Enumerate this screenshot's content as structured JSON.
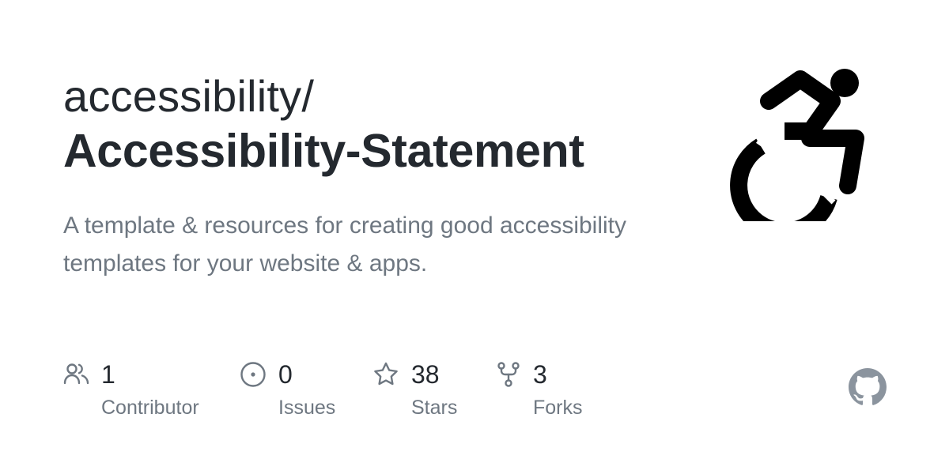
{
  "repo": {
    "owner": "accessibility/",
    "name": "Accessibility-Statement",
    "description": "A template & resources for creating good accessibility templates for your website & apps."
  },
  "logo": {
    "icon": "wheelchair-accessibility-icon"
  },
  "stats": [
    {
      "icon": "people-icon",
      "count": "1",
      "label": "Contributor"
    },
    {
      "icon": "issue-opened-icon",
      "count": "0",
      "label": "Issues"
    },
    {
      "icon": "star-icon",
      "count": "38",
      "label": "Stars"
    },
    {
      "icon": "repo-forked-icon",
      "count": "3",
      "label": "Forks"
    }
  ],
  "brand": {
    "icon": "github-mark-icon",
    "mark_color": "#8b949e"
  },
  "colors": {
    "text_primary": "#24292f",
    "text_secondary": "#6e7781",
    "background": "#ffffff"
  }
}
